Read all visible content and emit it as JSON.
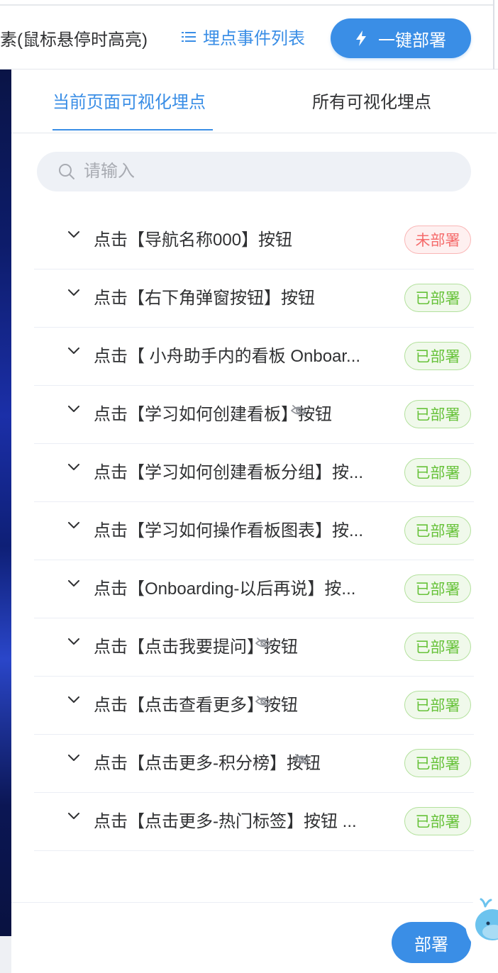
{
  "toolbar": {
    "hint_text": "素(鼠标悬停时高亮)",
    "event_list_label": "埋点事件列表",
    "deploy_all_label": "一键部署"
  },
  "tabs": [
    {
      "label": "当前页面可视化埋点",
      "active": true
    },
    {
      "label": "所有可视化埋点",
      "active": false
    }
  ],
  "search": {
    "placeholder": "请输入",
    "value": ""
  },
  "events": [
    {
      "label": "点击【导航名称000】按钮",
      "status": "未部署",
      "deployed": false,
      "hidden": false
    },
    {
      "label": "点击【右下角弹窗按钮】按钮",
      "status": "已部署",
      "deployed": true,
      "hidden": false
    },
    {
      "label": "点击【 小舟助手内的看板 Onboar...",
      "status": "已部署",
      "deployed": true,
      "hidden": false
    },
    {
      "label": "点击【学习如何创建看板】按钮",
      "status": "已部署",
      "deployed": true,
      "hidden": true
    },
    {
      "label": "点击【学习如何创建看板分组】按...",
      "status": "已部署",
      "deployed": true,
      "hidden": false
    },
    {
      "label": "点击【学习如何操作看板图表】按...",
      "status": "已部署",
      "deployed": true,
      "hidden": false
    },
    {
      "label": "点击【Onboarding-以后再说】按...",
      "status": "已部署",
      "deployed": true,
      "hidden": false
    },
    {
      "label": "点击【点击我要提问】按钮",
      "status": "已部署",
      "deployed": true,
      "hidden": true
    },
    {
      "label": "点击【点击查看更多】按钮",
      "status": "已部署",
      "deployed": true,
      "hidden": true
    },
    {
      "label": "点击【点击更多-积分榜】按钮",
      "status": "已部署",
      "deployed": true,
      "hidden": true
    },
    {
      "label": "点击【点击更多-热门标签】按钮 ...",
      "status": "已部署",
      "deployed": true,
      "hidden": false
    }
  ],
  "footer": {
    "deploy_label": "部署"
  },
  "colors": {
    "primary": "#3a8ee6",
    "success": "#67c23a",
    "danger": "#f56c6c"
  }
}
